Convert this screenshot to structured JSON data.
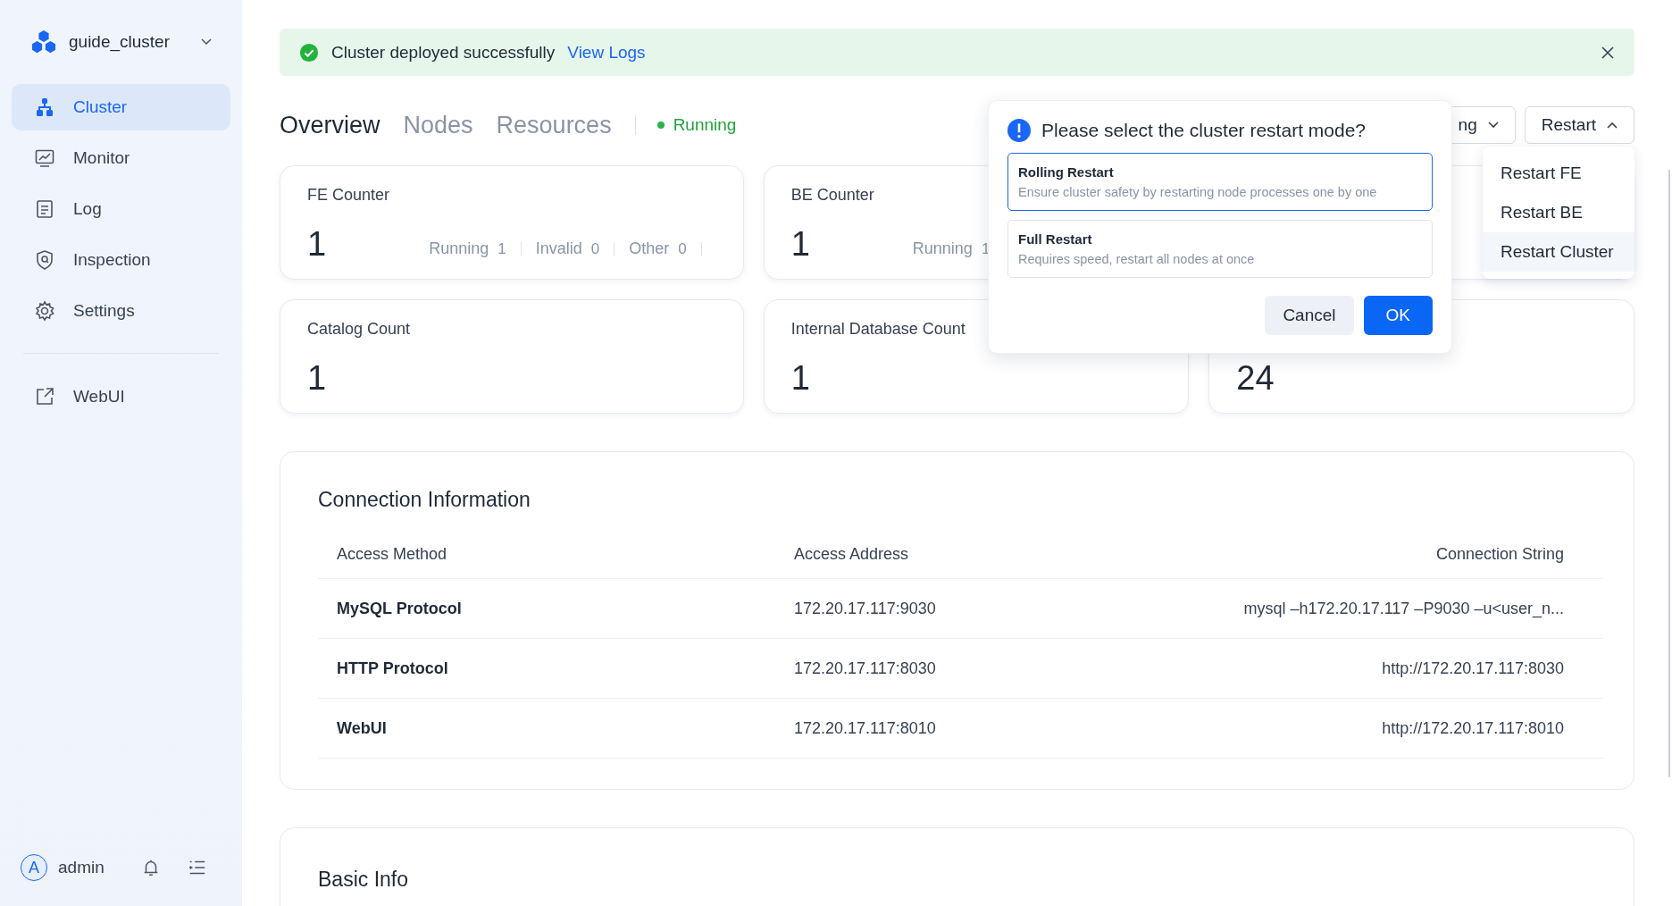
{
  "cluster_switcher": {
    "name": "guide_cluster"
  },
  "nav": [
    {
      "label": "Cluster",
      "selected": true
    },
    {
      "label": "Monitor",
      "selected": false
    },
    {
      "label": "Log",
      "selected": false
    },
    {
      "label": "Inspection",
      "selected": false
    },
    {
      "label": "Settings",
      "selected": false
    }
  ],
  "nav_external": {
    "label": "WebUI"
  },
  "user": {
    "avatar": "A",
    "name": "admin"
  },
  "alert": {
    "message": "Cluster deployed successfully",
    "link": "View Logs"
  },
  "tabs": [
    {
      "label": "Overview",
      "selected": true
    },
    {
      "label": "Nodes",
      "selected": false
    },
    {
      "label": "Resources",
      "selected": false
    }
  ],
  "status": {
    "label": "Running"
  },
  "toolbar_buttons": [
    {
      "label": "ng",
      "expanded": false
    },
    {
      "label": "Restart",
      "expanded": true
    }
  ],
  "stat_cards": [
    {
      "title": "FE Counter",
      "value": "1",
      "breakdown": [
        {
          "label": "Running",
          "value": "1"
        },
        {
          "label": "Invalid",
          "value": "0"
        },
        {
          "label": "Other",
          "value": "0"
        }
      ]
    },
    {
      "title": "BE Counter",
      "value": "1",
      "breakdown": [
        {
          "label": "Running",
          "value": "1"
        }
      ]
    },
    {
      "title": "Catalog Count",
      "value": "1"
    },
    {
      "title": "Internal Database Count",
      "value": "1"
    },
    {
      "value": "24"
    }
  ],
  "restart_menu": [
    {
      "label": "Restart FE",
      "selected": false
    },
    {
      "label": "Restart BE",
      "selected": false
    },
    {
      "label": "Restart Cluster",
      "selected": true
    }
  ],
  "restart_confirm": {
    "title": "Please select the cluster restart mode?",
    "options": [
      {
        "title": "Rolling Restart",
        "description": "Ensure cluster safety by restarting node processes one by one",
        "selected": true
      },
      {
        "title": "Full Restart",
        "description": "Requires speed, restart all nodes at once",
        "selected": false
      }
    ],
    "buttons": [
      {
        "label": "Cancel",
        "kind": "secondary"
      },
      {
        "label": "OK",
        "kind": "primary"
      }
    ]
  },
  "connection": {
    "title": "Connection Information",
    "columns": [
      "Access Method",
      "Access Address",
      "Connection String"
    ],
    "rows": [
      [
        "MySQL Protocol",
        "172.20.17.117:9030",
        "mysql –h172.20.17.117 –P9030 –u<user_n..."
      ],
      [
        "HTTP Protocol",
        "172.20.17.117:8030",
        "http://172.20.17.117:8030"
      ],
      [
        "WebUI",
        "172.20.17.117:8010",
        "http://172.20.17.117:8010"
      ]
    ]
  },
  "basic_info": {
    "title": "Basic Info"
  }
}
